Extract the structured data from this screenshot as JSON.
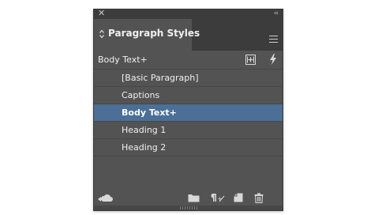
{
  "panel": {
    "close_glyph": "✕",
    "collapse_glyph": "‹‹",
    "tab_label": "Paragraph Styles",
    "current_style": "Body Text+"
  },
  "styles": [
    {
      "label": "[Basic Paragraph]",
      "selected": false
    },
    {
      "label": "Captions",
      "selected": false
    },
    {
      "label": "Body Text+",
      "selected": true
    },
    {
      "label": "Heading 1",
      "selected": false
    },
    {
      "label": "Heading 2",
      "selected": false
    }
  ],
  "colors": {
    "panel_bg": "#535353",
    "titlebar_bg": "#3c3c3c",
    "selection": "#4b6f96",
    "text": "#f0f0f0"
  },
  "icons": {
    "tab_arrows": "up-down-arrows-icon",
    "panel_menu": "hamburger-menu-icon",
    "new_override": "create-style-from-override-icon",
    "quick_apply": "lightning-icon",
    "cloud_library": "cloud-library-icon",
    "new_group": "folder-icon",
    "clear_overrides": "clear-overrides-icon",
    "new_style": "new-style-icon",
    "delete": "trash-icon"
  }
}
